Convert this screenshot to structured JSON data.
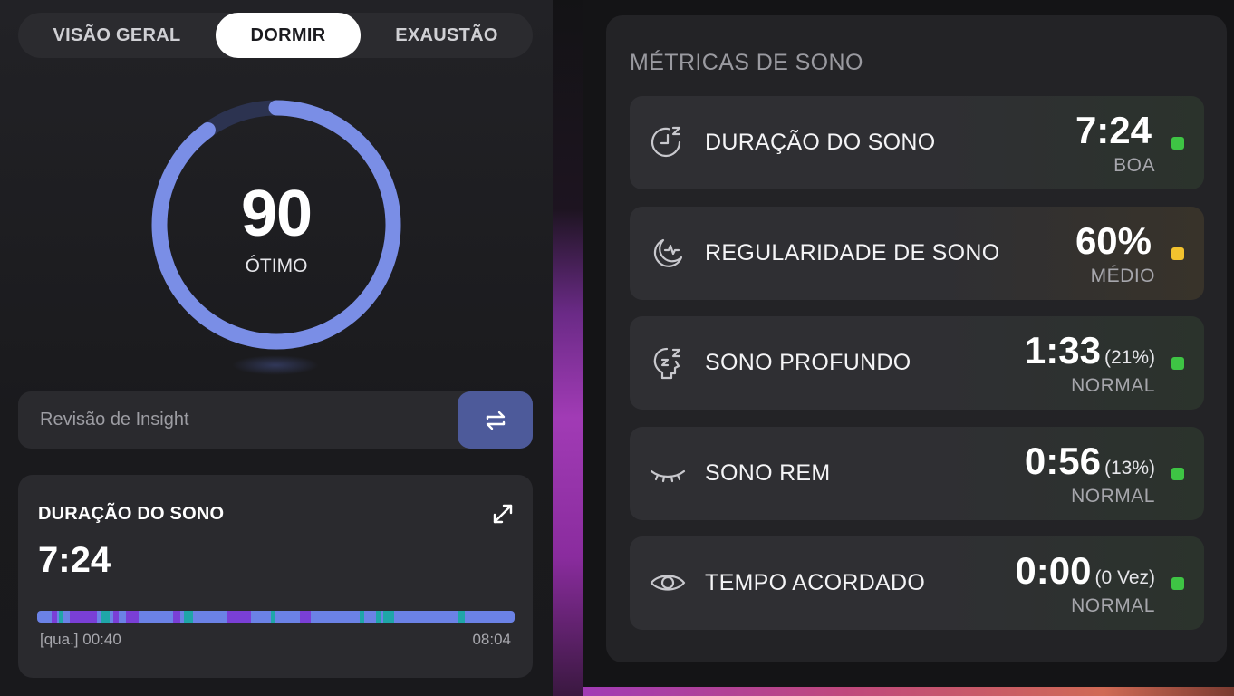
{
  "tabs": [
    {
      "label": "VISÃO GERAL",
      "active": false
    },
    {
      "label": "DORMIR",
      "active": true
    },
    {
      "label": "EXAUSTÃO",
      "active": false
    }
  ],
  "score": {
    "value": "90",
    "label": "ÓTIMO",
    "fraction": 0.9,
    "color": "#7a8ee6"
  },
  "insight": {
    "label": "Revisão de Insight",
    "button_icon": "swap-arrows-icon"
  },
  "duration_card": {
    "title": "DURAÇÃO DO SONO",
    "value": "7:24",
    "start": "[qua.] 00:40",
    "end": "08:04",
    "expand_icon": "expand-icon"
  },
  "metrics": {
    "title": "MÉTRICAS DE SONO",
    "rows": [
      {
        "icon": "clock-zz-icon",
        "label": "DURAÇÃO DO SONO",
        "value": "7:24",
        "extra": "",
        "status": "BOA",
        "color": "#3ec444"
      },
      {
        "icon": "moon-pulse-icon",
        "label": "REGULARIDADE DE SONO",
        "value": "60%",
        "extra": "",
        "status": "MÉDIO",
        "color": "#f2c22e"
      },
      {
        "icon": "head-zz-icon",
        "label": "SONO PROFUNDO",
        "value": "1:33",
        "extra": "(21%)",
        "status": "NORMAL",
        "color": "#3ec444"
      },
      {
        "icon": "closed-eye-icon",
        "label": "SONO REM",
        "value": "0:56",
        "extra": "(13%)",
        "status": "NORMAL",
        "color": "#3ec444"
      },
      {
        "icon": "eye-icon",
        "label": "TEMPO ACORDADO",
        "value": "0:00",
        "extra": "(0 Vez)",
        "status": "NORMAL",
        "color": "#3ec444"
      }
    ]
  }
}
